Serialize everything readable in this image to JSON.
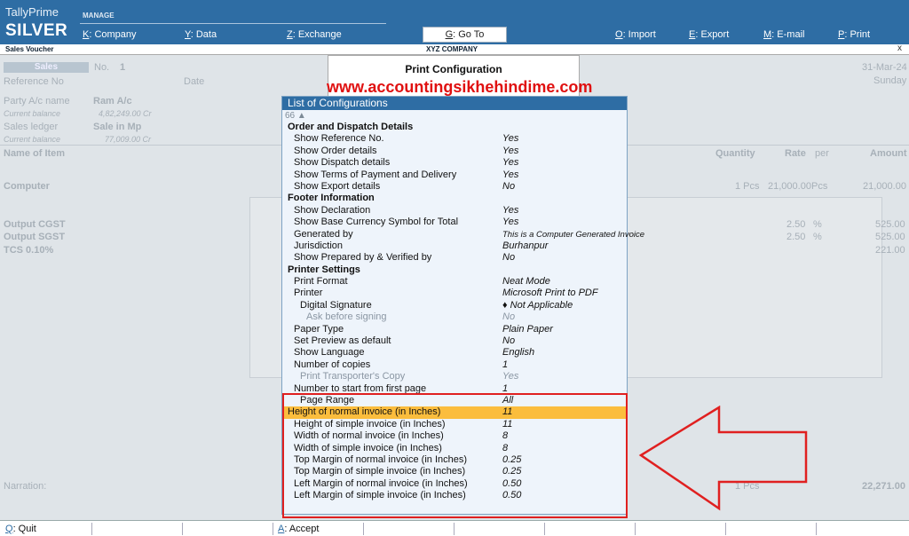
{
  "brand": {
    "name": "TallyPrime",
    "edition": "SILVER"
  },
  "topmenu": {
    "manage_label": "MANAGE",
    "company": {
      "key": "K",
      "label": ": Company"
    },
    "data": {
      "key": "Y",
      "label": ": Data"
    },
    "exchange": {
      "key": "Z",
      "label": ": Exchange"
    },
    "goto": {
      "key": "G",
      "label": ": Go To"
    },
    "import": {
      "key": "O",
      "label": ": Import"
    },
    "export": {
      "key": "E",
      "label": ": Export"
    },
    "email": {
      "key": "M",
      "label": ": E-mail"
    },
    "print": {
      "key": "P",
      "label": ": Print"
    }
  },
  "subbar": {
    "screen": "Sales Voucher",
    "company": "XYZ COMPANY",
    "close": "x"
  },
  "voucher": {
    "type": "Sales",
    "no_label": "No.",
    "no": "1",
    "date": "31-Mar-24",
    "day": "Sunday",
    "reference_label": "Reference No",
    "date_label": "Date",
    "party_label": "Party A/c name",
    "party": "Ram A/c",
    "current_balance_label": "Current balance",
    "party_balance": "4,82,249.00 Cr",
    "sales_ledger_label": "Sales ledger",
    "sales_ledger": "Sale in Mp",
    "sales_balance": "77,009.00 Cr",
    "col_item": "Name of Item",
    "col_qty": "Quantity",
    "col_rate": "Rate",
    "col_per": "per",
    "col_amount": "Amount",
    "item": "Computer",
    "item_qty": "1 Pcs",
    "item_rate": "21,000.00",
    "item_per": "Pcs",
    "item_amount": "21,000.00",
    "cgst_label": "Output CGST",
    "cgst_rate": "2.50",
    "cgst_pct": "%",
    "cgst_amount": "525.00",
    "sgst_label": "Output SGST",
    "sgst_rate": "2.50",
    "sgst_pct": "%",
    "sgst_amount": "525.00",
    "tcs_label": "TCS 0.10%",
    "tcs_amount": "221.00",
    "narration_label": "Narration:",
    "total_qty": "1 Pcs",
    "total_amount": "22,271.00"
  },
  "print_config": {
    "title": "Print Configuration",
    "watermark": "www.accountingsikhehindime.com",
    "list_title": "List of Configurations",
    "count": "66 ▲",
    "rows": [
      {
        "label": "Order and Dispatch Details",
        "value": ""
      },
      {
        "label": "Show Reference No.",
        "value": "Yes"
      },
      {
        "label": "Show Order details",
        "value": "Yes"
      },
      {
        "label": "Show Dispatch details",
        "value": "Yes"
      },
      {
        "label": "Show Terms of Payment and Delivery",
        "value": "Yes"
      },
      {
        "label": "Show Export details",
        "value": "No"
      },
      {
        "label": "Footer Information",
        "value": ""
      },
      {
        "label": "Show Declaration",
        "value": "Yes"
      },
      {
        "label": "Show Base Currency Symbol for Total",
        "value": "Yes"
      },
      {
        "label": "Generated by",
        "value": "This is a Computer Generated Invoice"
      },
      {
        "label": "Jurisdiction",
        "value": "Burhanpur"
      },
      {
        "label": "Show Prepared by & Verified by",
        "value": "No"
      },
      {
        "label": "Printer Settings",
        "value": ""
      },
      {
        "label": "Print Format",
        "value": "Neat Mode"
      },
      {
        "label": "Printer",
        "value": "Microsoft Print to PDF"
      },
      {
        "label": "Digital Signature",
        "value": "♦ Not Applicable"
      },
      {
        "label": "Ask before signing",
        "value": "No"
      },
      {
        "label": "Paper Type",
        "value": "Plain Paper"
      },
      {
        "label": "Set Preview as default",
        "value": "No"
      },
      {
        "label": "Show Language",
        "value": "English"
      },
      {
        "label": "Number of copies",
        "value": "1"
      },
      {
        "label": "Print Transporter's Copy",
        "value": "Yes"
      },
      {
        "label": "Number to start from first page",
        "value": "1"
      },
      {
        "label": "Page Range",
        "value": "All"
      },
      {
        "label": "Height of normal invoice (in Inches)",
        "value": "11"
      },
      {
        "label": "Height of simple invoice (in Inches)",
        "value": "11"
      },
      {
        "label": "Width of normal invoice (in Inches)",
        "value": "8"
      },
      {
        "label": "Width of simple invoice (in Inches)",
        "value": "8"
      },
      {
        "label": "Top Margin of normal invoice (in Inches)",
        "value": "0.25"
      },
      {
        "label": "Top Margin of simple invoice (in Inches)",
        "value": "0.25"
      },
      {
        "label": "Left Margin of normal invoice (in Inches)",
        "value": "0.50"
      },
      {
        "label": "Left Margin of simple invoice (in Inches)",
        "value": "0.50"
      }
    ]
  },
  "bottombar": {
    "quit": {
      "key": "Q",
      "label": ": Quit"
    },
    "accept": {
      "key": "A",
      "label": ": Accept"
    }
  },
  "colors": {
    "accent": "#2e6da4",
    "selected": "#fbbd3d",
    "highlight_border": "#e02020"
  }
}
